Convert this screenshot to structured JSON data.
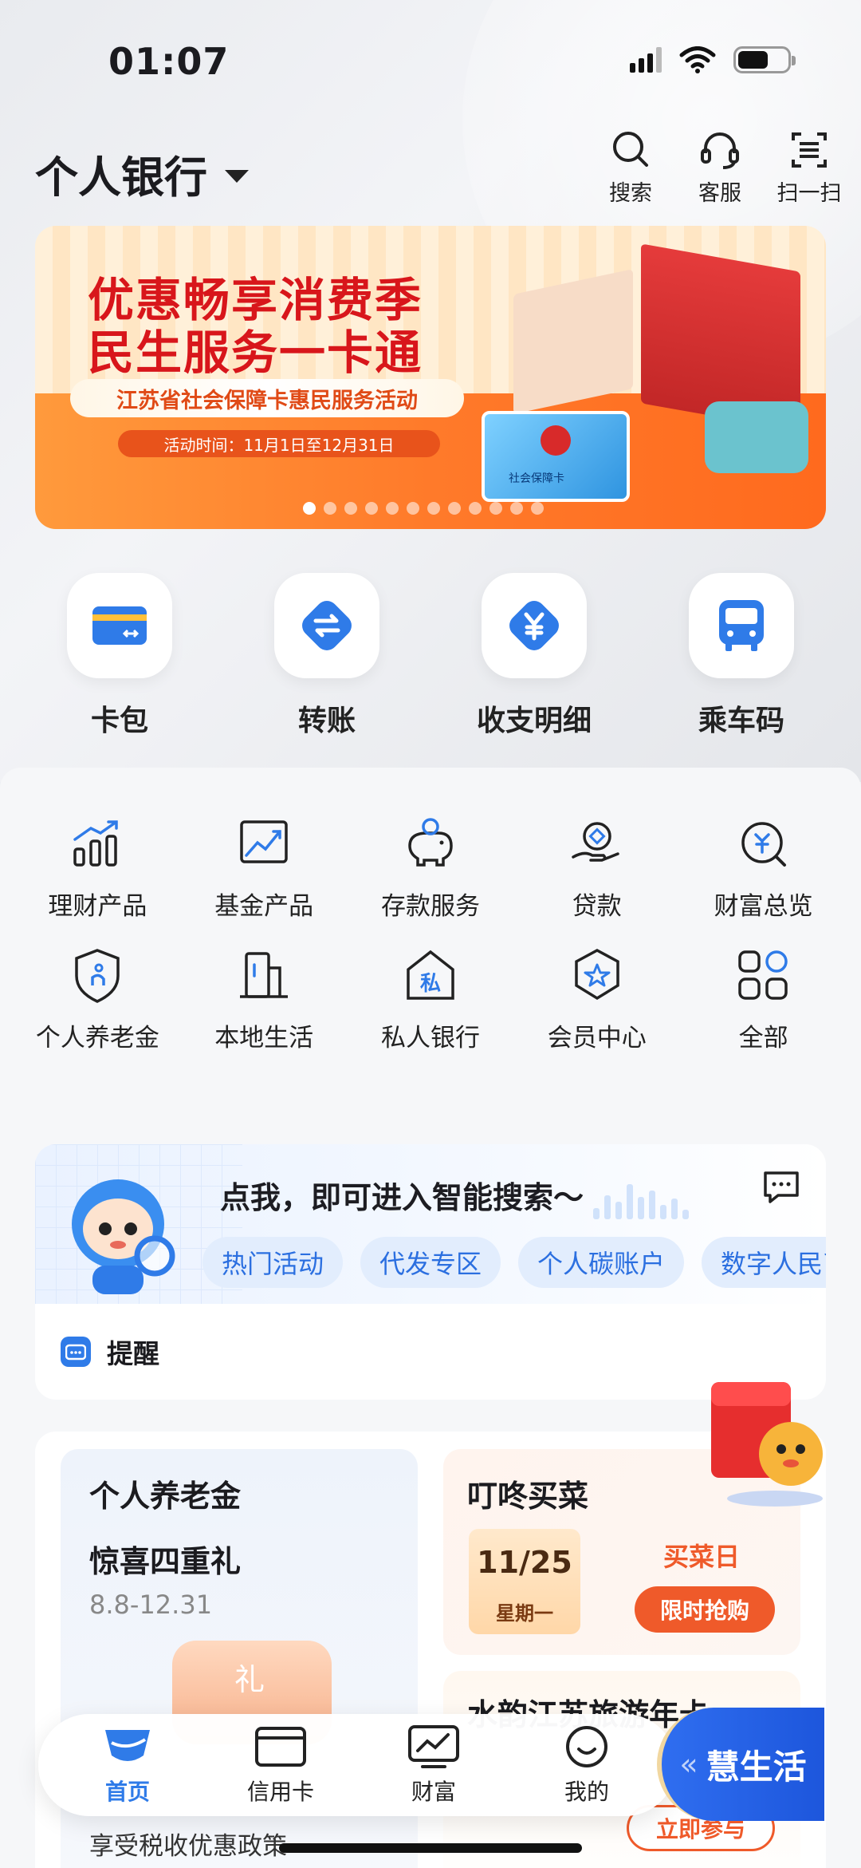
{
  "status_bar": {
    "time": "01:07"
  },
  "header": {
    "title": "个人银行",
    "actions": [
      {
        "label": "搜索",
        "icon": "search-icon"
      },
      {
        "label": "客服",
        "icon": "headset-icon"
      },
      {
        "label": "扫一扫",
        "icon": "scan-icon"
      }
    ]
  },
  "banner": {
    "headline_1": "优惠畅享消费季",
    "headline_2": "民生服务一卡通",
    "subtitle": "江苏省社会保障卡惠民服务活动",
    "date": "活动时间：11月1日至12月31日",
    "card_text": "社会保障卡",
    "slide_count": 12,
    "active_slide": 1
  },
  "quick_actions": [
    {
      "label": "卡包",
      "icon": "card-wallet-icon"
    },
    {
      "label": "转账",
      "icon": "transfer-icon"
    },
    {
      "label": "收支明细",
      "icon": "yuan-detail-icon"
    },
    {
      "label": "乘车码",
      "icon": "bus-code-icon"
    }
  ],
  "services": [
    {
      "label": "理财产品",
      "icon": "bar-chart-icon"
    },
    {
      "label": "基金产品",
      "icon": "trend-chart-icon"
    },
    {
      "label": "存款服务",
      "icon": "piggy-bank-icon"
    },
    {
      "label": "贷款",
      "icon": "loan-hand-icon"
    },
    {
      "label": "财富总览",
      "icon": "wealth-search-icon"
    },
    {
      "label": "个人养老金",
      "icon": "pension-shield-icon"
    },
    {
      "label": "本地生活",
      "icon": "building-icon"
    },
    {
      "label": "私人银行",
      "icon": "private-house-icon"
    },
    {
      "label": "会员中心",
      "icon": "member-star-icon"
    },
    {
      "label": "全部",
      "icon": "all-grid-icon"
    }
  ],
  "smart_search": {
    "prompt": "点我，即可进入智能搜索～",
    "chips": [
      "热门活动",
      "代发专区",
      "个人碳账户",
      "数字人民币"
    ]
  },
  "reminder": {
    "label": "提醒"
  },
  "promos": {
    "pension": {
      "title": "个人养老金",
      "headline": "惊喜四重礼",
      "dates": "8.8-12.31"
    },
    "grocery": {
      "title": "叮咚买菜",
      "date": "11/25",
      "weekday": "星期一",
      "tag": "买菜日",
      "button": "限时抢购"
    },
    "travel": {
      "title": "水韵江苏旅游年卡",
      "button": "立即参与"
    },
    "tax_line": "享受税收优惠政策"
  },
  "bottom_nav": [
    {
      "label": "首页",
      "icon": "home-icon",
      "active": true
    },
    {
      "label": "信用卡",
      "icon": "credit-card-icon",
      "active": false
    },
    {
      "label": "财富",
      "icon": "wealth-chart-icon",
      "active": false
    },
    {
      "label": "我的",
      "icon": "profile-smile-icon",
      "active": false
    }
  ],
  "life_button": {
    "label": "慧生活"
  },
  "colors": {
    "brand_blue": "#2f7be8",
    "accent_orange": "#ef5a2a",
    "banner_red": "#d8161b"
  }
}
